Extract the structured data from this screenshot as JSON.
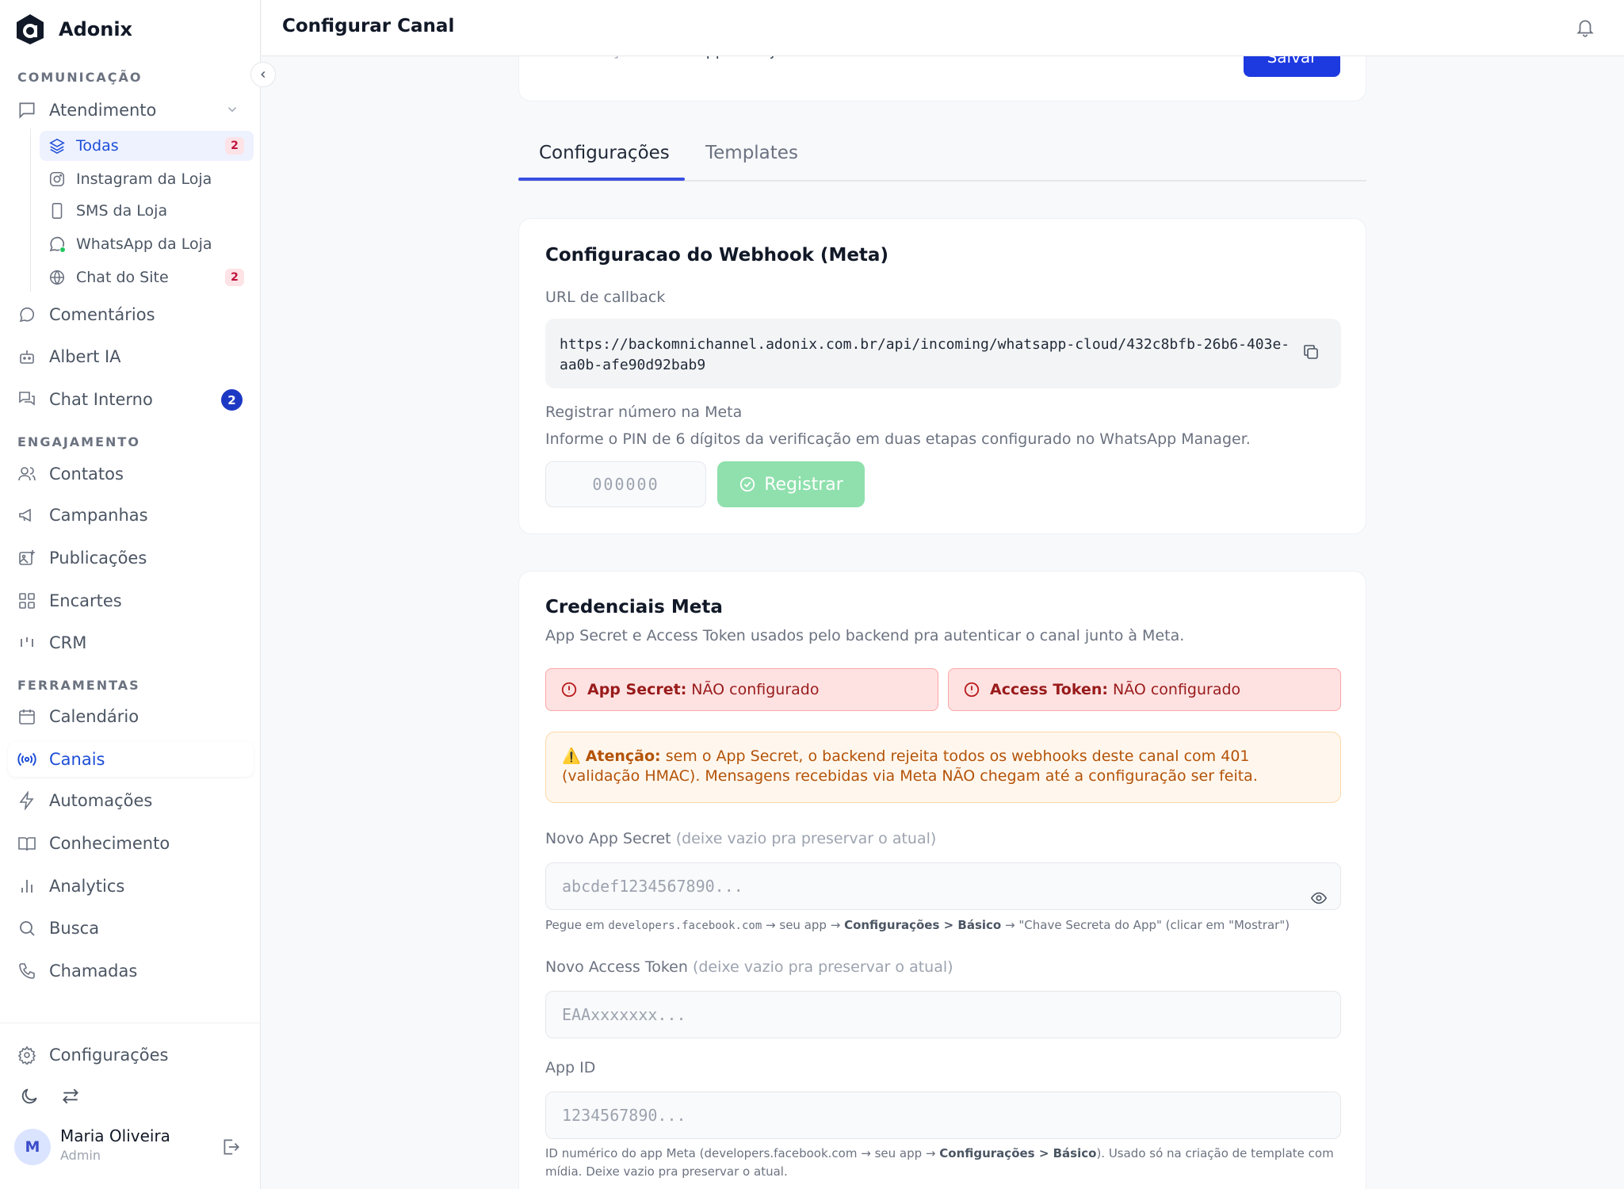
{
  "brand": {
    "name": "Adonix"
  },
  "header": {
    "title": "Configurar Canal"
  },
  "sidebar": {
    "sections": {
      "comunicacao": "COMUNICAÇÃO",
      "engajamento": "ENGAJAMENTO",
      "ferramentas": "FERRAMENTAS"
    },
    "atendimento": {
      "label": "Atendimento"
    },
    "sub_items": [
      {
        "label": "Todas",
        "badge": "2"
      },
      {
        "label": "Instagram da Loja"
      },
      {
        "label": "SMS da Loja"
      },
      {
        "label": "WhatsApp da Loja"
      },
      {
        "label": "Chat do Site",
        "badge": "2"
      }
    ],
    "comentarios": "Comentários",
    "albert": "Albert IA",
    "chat_interno": {
      "label": "Chat Interno",
      "badge": "2"
    },
    "contatos": "Contatos",
    "campanhas": "Campanhas",
    "publicacoes": "Publicações",
    "encartes": "Encartes",
    "crm": "CRM",
    "calendario": "Calendário",
    "canais": "Canais",
    "automacoes": "Automações",
    "conhecimento": "Conhecimento",
    "analytics": "Analytics",
    "busca": "Busca",
    "chamadas": "Chamadas",
    "configuracoes": "Configurações",
    "user": {
      "initial": "M",
      "name": "Maria Oliveira",
      "role": "Admin"
    }
  },
  "top_card": {
    "viz_label": "Visualização:",
    "viz_value": "WhatsApp da Loja",
    "save_label": "Salvar"
  },
  "tabs": [
    {
      "label": "Configurações"
    },
    {
      "label": "Templates"
    }
  ],
  "webhook": {
    "title": "Configuracao do Webhook (Meta)",
    "callback_label": "URL de callback",
    "callback_url": "https://backomnichannel.adonix.com.br/api/incoming/whatsapp-cloud/432c8bfb-26b6-403e-aa0b-afe90d92bab9",
    "register_label": "Registrar número na Meta",
    "register_help": "Informe o PIN de 6 dígitos da verificação em duas etapas configurado no WhatsApp Manager.",
    "pin_placeholder": "000000",
    "register_button": "Registrar"
  },
  "credentials": {
    "title": "Credenciais Meta",
    "subtitle": "App Secret e Access Token usados pelo backend pra autenticar o canal junto à Meta.",
    "app_secret_status": {
      "key": "App Secret:",
      "value": "NÃO configurado"
    },
    "access_token_status": {
      "key": "Access Token:",
      "value": "NÃO configurado"
    },
    "warning": {
      "icon": "⚠️",
      "key": "Atenção:",
      "text": "sem o App Secret, o backend rejeita todos os webhooks deste canal com 401 (validação HMAC). Mensagens recebidas via Meta NÃO chegam até a configuração ser feita."
    },
    "app_secret_label": "Novo App Secret",
    "app_secret_label_muted": "(deixe vazio pra preservar o atual)",
    "app_secret_placeholder": "abcdef1234567890...",
    "app_secret_hint": {
      "pre": "Pegue em",
      "code": "developers.facebook.com",
      "mid": "→ seu app →",
      "bold": "Configurações > Básico",
      "post": "→ \"Chave Secreta do App\" (clicar em \"Mostrar\")"
    },
    "access_token_label": "Novo Access Token",
    "access_token_label_muted": "(deixe vazio pra preservar o atual)",
    "access_token_placeholder": "EAAxxxxxxx...",
    "app_id_label": "App ID",
    "app_id_placeholder": "1234567890...",
    "app_id_hint": {
      "pre": "ID numérico do app Meta (developers.facebook.com → seu app →",
      "bold": "Configurações > Básico",
      "post": "). Usado só na criação de template com mídia. Deixe vazio pra preservar o atual."
    }
  },
  "colors": {
    "accent": "#1d39e0",
    "success_soft": "#8fe0ad",
    "danger_bg": "#fee2e2",
    "warning_bg": "#fff7ed"
  }
}
